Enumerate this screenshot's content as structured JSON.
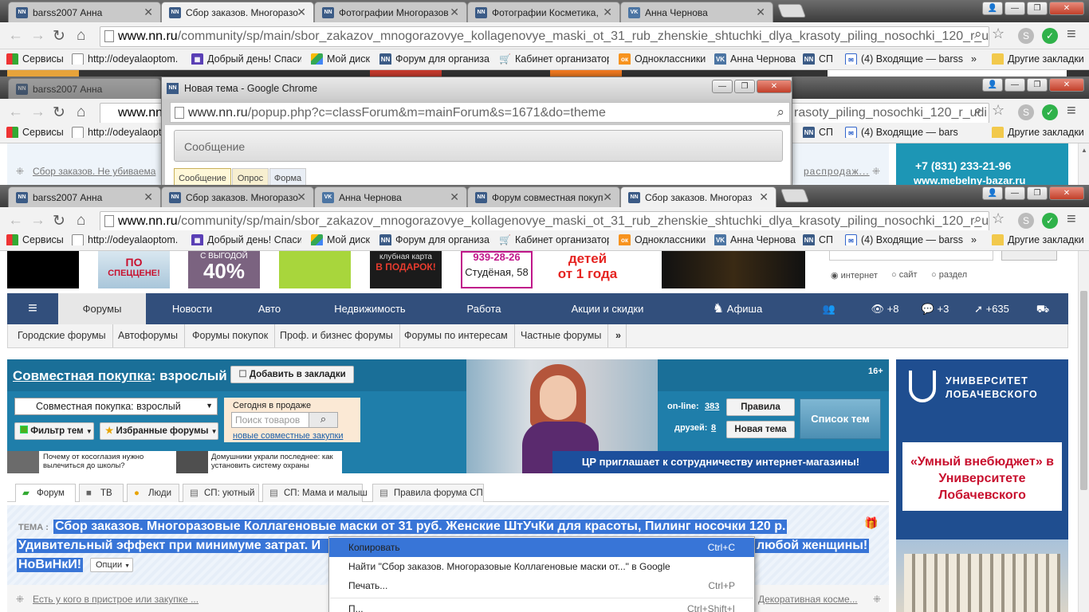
{
  "colors": {
    "site_nav": "#324f7c",
    "banner": "#1f7eaa",
    "selection": "#3875d7"
  },
  "window1": {
    "tabs": [
      {
        "icon": "NN",
        "title": "barss2007 Анна"
      },
      {
        "icon": "NN",
        "title": "Сбор заказов. Многоразо"
      },
      {
        "icon": "NN",
        "title": "Фотографии Многоразов"
      },
      {
        "icon": "NN",
        "title": "Фотографии Косметика,"
      },
      {
        "icon": "VK",
        "title": "Анна Чернова"
      }
    ],
    "url_host": "www.nn.ru",
    "url_path": "/community/sp/main/sbor_zakazov_mnogorazovye_kollagenovye_maski_ot_31_rub_zhenskie_shtuchki_dlya_krasoty_piling_nosochki_120_r_udi"
  },
  "window2": {
    "tabs": [
      {
        "icon": "NN",
        "title": "barss2007 Анна"
      }
    ],
    "url_host": "www.nn.ru",
    "url_path_tail": "rasoty_piling_nosochki_120_r_udi",
    "bookmarks": [
      "Сервисы",
      "http://odeyalaoptom",
      "СП",
      "(4) Входящие — bars",
      "Другие закладки"
    ],
    "side_phone": "+7 (831) 233-21-96",
    "side_site": "www.mebelny-bazar.ru",
    "behind_row": "Сбор заказов. Не убиваема",
    "behind_row2": "распродаж..."
  },
  "popup": {
    "title": "Новая тема - Google Chrome",
    "url_host": "www.nn.ru",
    "url_path": "/popup.php?c=classForum&m=mainForum&s=1671&do=theme",
    "message_label": "Сообщение",
    "tabs": [
      "Сообщение",
      "Опрос",
      "Форма"
    ]
  },
  "window3": {
    "tabs": [
      {
        "icon": "NN",
        "title": "barss2007 Анна"
      },
      {
        "icon": "NN",
        "title": "Сбор заказов. Многоразо"
      },
      {
        "icon": "VK",
        "title": "Анна Чернова"
      },
      {
        "icon": "NN",
        "title": "Форум совместная покуп"
      },
      {
        "icon": "NN",
        "title": "Сбор заказов. Многораз"
      }
    ],
    "url_host": "www.nn.ru",
    "url_path": "/community/sp/main/sbor_zakazov_mnogorazovye_kollagenovye_maski_ot_31_rub_zhenskie_shtuchki_dlya_krasoty_piling_nosochki_120_r_udi"
  },
  "bookmarks": [
    "Сервисы",
    "http://odeyalaoptom.",
    "Добрый день! Спаси",
    "Мой диск",
    "Форум для организат",
    "Кабинет организатор",
    "Одноклассники",
    "Анна Чернова",
    "СП",
    "(4) Входящие — barss",
    "»",
    "Другие закладки"
  ],
  "ads": {
    "ad2_line1": "ПО",
    "ad2_line2": "СПЕЦЦЕНЕ!",
    "ad3_line1": "С ВЫГОДОЙ",
    "ad3_line2": "40%",
    "ad5_line1": "клубная карта",
    "ad5_line2": "В ПОДАРОК!",
    "ad6_line1": "939-28-26",
    "ad6_line2": "Студёная, 58",
    "ad7_line1": "детей",
    "ad7_line2": "от 1 года"
  },
  "search": {
    "opt1": "интернет",
    "opt2": "сайт",
    "opt3": "раздел"
  },
  "nav": {
    "forums": "Форумы",
    "news": "Новости",
    "auto": "Авто",
    "realty": "Недвижимость",
    "work": "Работа",
    "promo": "Акции и скидки",
    "afisha": "Афиша",
    "views": "+8",
    "messages": "+3",
    "rating": "+635"
  },
  "subnav": [
    "Городские форумы",
    "Автофорумы",
    "Форумы покупок",
    "Проф. и бизнес форумы",
    "Форумы по интересам",
    "Частные форумы"
  ],
  "community": {
    "title_link": "Совместная покупка",
    "title_rest": ": взрослый",
    "bookmark_btn": "Добавить в закладки",
    "age": "16+",
    "select_value": "Совместная покупка: взрослый",
    "filter_btn": "Фильтр тем",
    "fav_btn": "Избранные форумы",
    "today_label": "Сегодня в продаже",
    "search_placeholder": "Поиск товаров",
    "new_link": "новые совместные закупки",
    "online_label": "on-line:",
    "online_count": "383",
    "friends_label": "друзей:",
    "friends_count": "8",
    "rules_btn": "Правила",
    "new_theme_btn": "Новая тема",
    "list_btn": "Список тем",
    "news1": "Почему от косоглазия нужно вылечиться до школы?",
    "news2": "Домушники украли последнее: как установить систему охраны",
    "promo_text": "ЦР приглашает к сотрудничеству интернет-магазины!"
  },
  "forum_tabs": [
    "Форум",
    "ТВ",
    "Люди",
    "СП: уютный",
    "СП: Мама и малыш",
    "Правила форума СП"
  ],
  "topic": {
    "label": "ТЕМА :",
    "line1": "Сбор заказов. Многоразовые Коллагеновые маски от 31 руб. Женские ШтУчКи для красоты, Пилинг носочки 120 р.",
    "line2_start": "Удивительный эффект при минимуме затрат. И",
    "line2_end": "любой женщины!",
    "line3": "НоВиНкИ!",
    "options_btn": "Опции"
  },
  "bottom_row": {
    "left": "Есть у кого в пристрое или закупке ...",
    "right": "Декоративная косме..."
  },
  "context_menu": [
    {
      "label": "Копировать",
      "shortcut": "Ctrl+C"
    },
    {
      "label": "Найти \"Сбор заказов. Многоразовые Коллагеновые маски от...\" в Google",
      "shortcut": ""
    },
    {
      "label": "Печать...",
      "shortcut": "Ctrl+P"
    },
    {
      "label": "П...",
      "shortcut": "Ctrl+Shift+I"
    }
  ],
  "right_ad": {
    "title1": "УНИВЕРСИТЕТ",
    "title2": "ЛОБАЧЕВСКОГО",
    "quote": "«Умный внебюджет» в Университете Лобачевского"
  }
}
